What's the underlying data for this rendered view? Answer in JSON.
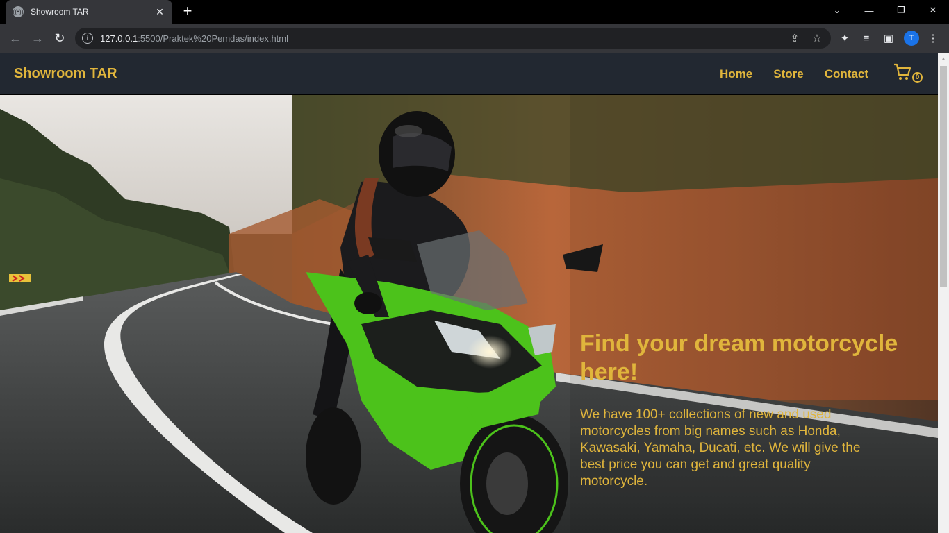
{
  "browser": {
    "tab_title": "Showroom TAR",
    "tab_close": "✕",
    "new_tab": "+",
    "url_host": "127.0.0.1",
    "url_rest": ":5500/Praktek%20Pemdas/index.html",
    "profile_initial": "T",
    "window_controls": {
      "dropdown": "⌄",
      "minimize": "—",
      "restore": "❐",
      "close": "✕"
    }
  },
  "navbar": {
    "brand": "Showroom TAR",
    "links": [
      "Home",
      "Store",
      "Contact"
    ],
    "cart_count": "0"
  },
  "hero": {
    "title": "Find your dream motorcycle here!",
    "text": "We have 100+ collections of new and used motorcycles from big names such as Honda, Kawasaki, Yamaha, Ducati, etc. We will give the best price you can get and great quality motorcycle."
  },
  "colors": {
    "accent": "#e0b53c",
    "navbar_bg": "#222831"
  }
}
